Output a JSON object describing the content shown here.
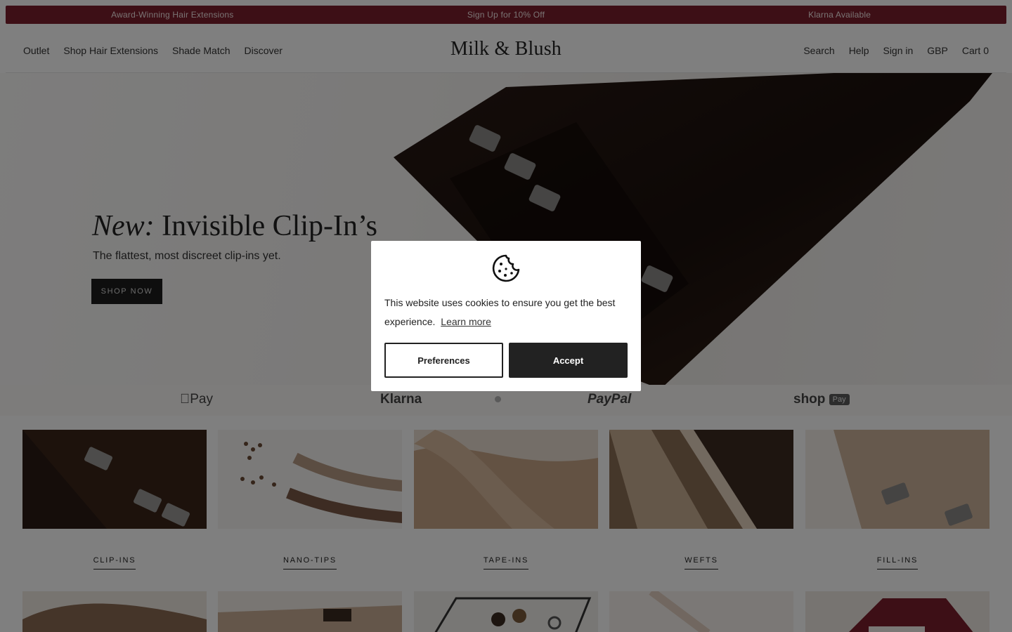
{
  "announcement": [
    "Award-Winning Hair Extensions",
    "Sign Up for 10% Off",
    "Klarna Available"
  ],
  "header": {
    "logo": "Milk & Blush",
    "nav_left": [
      "Outlet",
      "Shop Hair Extensions",
      "Shade Match",
      "Discover"
    ],
    "nav_right": {
      "search": "Search",
      "help": "Help",
      "signin": "Sign in",
      "currency": "GBP",
      "cart": "Cart 0"
    }
  },
  "hero": {
    "title_italic": "New:",
    "title_rest": "Invisible Clip-In’s",
    "subtitle": "The flattest, most discreet clip-ins yet.",
    "cta": "SHOP NOW"
  },
  "payments": [
    "Pay",
    "Klarna",
    "PayPal",
    "shop",
    "Pay"
  ],
  "categories": [
    "CLIP-INS",
    "NANO-TIPS",
    "TAPE-INS",
    "WEFTS",
    "FILL-INS"
  ],
  "cookie_modal": {
    "icon": "cookie-icon",
    "text": "This website uses cookies to ensure you get the best experience.",
    "learn_more": "Learn more",
    "preferences": "Preferences",
    "accept": "Accept"
  },
  "colors": {
    "announce_bg": "#7a1e2c",
    "dark": "#1c1c1c",
    "overlay": "rgba(0,0,0,0.5)"
  }
}
